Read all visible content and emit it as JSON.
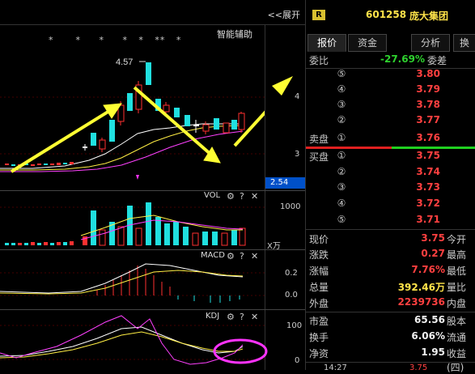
{
  "chart": {
    "expand_label": "<<展开",
    "assist_label": "智能辅助",
    "high_label": "4.57",
    "current_price_tag": "2.54",
    "axis_price_4": "4",
    "axis_price_3": "3",
    "star_marks": "*      *     *     *   *   **   *",
    "vol_title": "VOL",
    "vol_axis_1000": "1000",
    "vol_unit": "X万",
    "macd_title": "MACD",
    "macd_axis_02": "0.2",
    "macd_axis_00": "0.0",
    "kdj_title": "KDJ",
    "kdj_axis_100": "100",
    "kdj_axis_0": "0",
    "gear_icon": "⚙",
    "help_icon": "?",
    "close_icon": "✕",
    "colors": {
      "up": "#ff3030",
      "down": "#20e0e0",
      "ma_white": "#ffffff",
      "ma_yellow": "#ffee44",
      "ma_magenta": "#ff40ff",
      "arrow": "#ffff33",
      "circle": "#ff33ff"
    }
  },
  "stock": {
    "badge": "R",
    "code": "601258",
    "name": "庞大集团"
  },
  "tabs": [
    "报价",
    "资金",
    "分析",
    "换"
  ],
  "orderbook": {
    "ratio_label": "委比",
    "ratio_value": "-27.69%",
    "diff_label": "委差",
    "sell_label": "卖盘",
    "buy_label": "买盘",
    "sells": [
      {
        "n": "⑤",
        "price": "3.80"
      },
      {
        "n": "④",
        "price": "3.79"
      },
      {
        "n": "③",
        "price": "3.78"
      },
      {
        "n": "②",
        "price": "3.77"
      },
      {
        "n": "①",
        "price": "3.76"
      }
    ],
    "buys": [
      {
        "n": "①",
        "price": "3.75"
      },
      {
        "n": "②",
        "price": "3.74"
      },
      {
        "n": "③",
        "price": "3.73"
      },
      {
        "n": "④",
        "price": "3.72"
      },
      {
        "n": "⑤",
        "price": "3.71"
      }
    ]
  },
  "quote": {
    "rows": [
      {
        "l": "现价",
        "v": "3.75",
        "vc": "red",
        "r": "今开"
      },
      {
        "l": "涨跌",
        "v": "0.27",
        "vc": "red",
        "r": "最高"
      },
      {
        "l": "涨幅",
        "v": "7.76%",
        "vc": "red",
        "r": "最低"
      },
      {
        "l": "总量",
        "v": "392.46万",
        "vc": "yel",
        "r": "量比"
      },
      {
        "l": "外盘",
        "v": "2239736",
        "vc": "red",
        "r": "内盘"
      },
      {
        "l": "市盈",
        "v": "65.56",
        "vc": "wht",
        "r": "股本"
      },
      {
        "l": "换手",
        "v": "6.06%",
        "vc": "wht",
        "r": "流通"
      },
      {
        "l": "净资",
        "v": "1.95",
        "vc": "wht",
        "r": "收益(四)"
      }
    ],
    "last_time": "14:27",
    "last_price": "3.75"
  }
}
